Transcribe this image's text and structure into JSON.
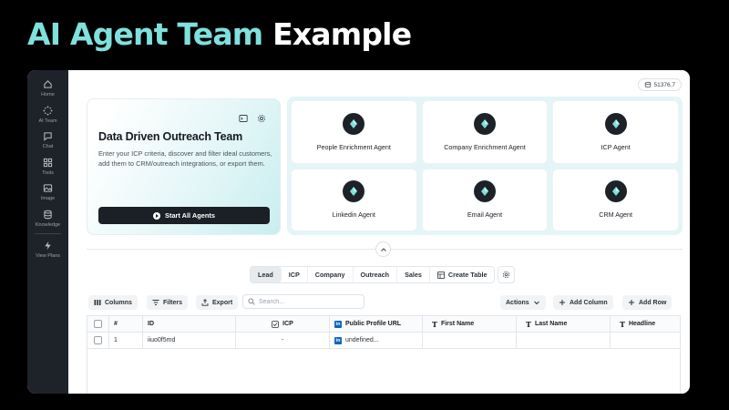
{
  "headline": {
    "accent": "AI Agent Team",
    "plain": "Example"
  },
  "sidebar": {
    "items": [
      {
        "label": "Home",
        "icon": "home-icon"
      },
      {
        "label": "AI Team",
        "icon": "sparkle-icon"
      },
      {
        "label": "Chat",
        "icon": "chat-icon"
      },
      {
        "label": "Tools",
        "icon": "grid-icon"
      },
      {
        "label": "Image",
        "icon": "image-icon"
      },
      {
        "label": "Knowledge",
        "icon": "database-icon"
      },
      {
        "label": "View Plans",
        "icon": "bolt-icon"
      }
    ]
  },
  "credits": {
    "value": "51376.7",
    "icon": "coins-icon"
  },
  "hero": {
    "title": "Data Driven Outreach Team",
    "description": "Enter your ICP criteria, discover and filter ideal customers, add them to CRM/outreach integrations, or export them.",
    "start_label": "Start All Agents"
  },
  "agents": [
    {
      "name": "People Enrichment Agent"
    },
    {
      "name": "Company Enrichment Agent"
    },
    {
      "name": "ICP Agent"
    },
    {
      "name": "Linkedin Agent"
    },
    {
      "name": "Email Agent"
    },
    {
      "name": "CRM Agent"
    }
  ],
  "tabs": [
    {
      "label": "Lead",
      "active": true
    },
    {
      "label": "ICP"
    },
    {
      "label": "Company"
    },
    {
      "label": "Outreach"
    },
    {
      "label": "Sales"
    },
    {
      "label": "Create Table"
    }
  ],
  "toolbar": {
    "columns": "Columns",
    "filters": "Filters",
    "export": "Export",
    "search_placeholder": "Search...",
    "actions": "Actions",
    "add_column": "Add Column",
    "add_row": "Add Row"
  },
  "table": {
    "headers": [
      "#",
      "ID",
      "ICP",
      "Public Profile URL",
      "First Name",
      "Last Name",
      "Headline"
    ],
    "rows": [
      {
        "num": "1",
        "id": "iiuo0f5md",
        "icp": "-",
        "url": "undefined...",
        "first": "",
        "last": "",
        "headline": ""
      }
    ]
  },
  "colors": {
    "accent": "#7fe0dd",
    "rail": "#1d2329",
    "agent_panel": "#e4f5f7"
  }
}
